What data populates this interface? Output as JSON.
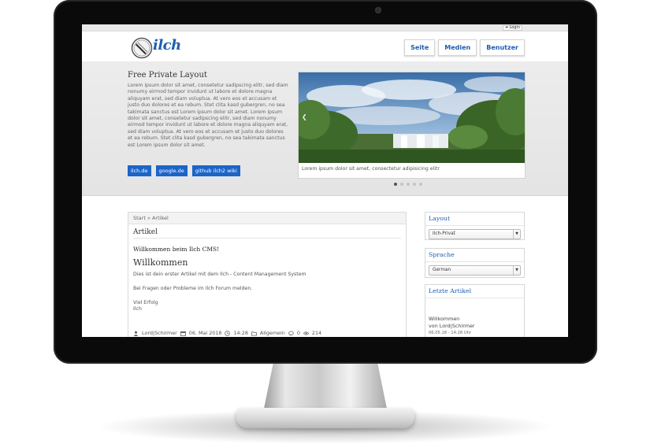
{
  "topbar": {
    "login_label": "Login"
  },
  "header": {
    "logo_text": "ilch",
    "nav": [
      "Seite",
      "Medien",
      "Benutzer"
    ]
  },
  "hero": {
    "title": "Free Private Layout",
    "text": "Lorem ipsum dolor sit amet, consetetur sadipscing elitr, sed diam nonumy eirmod tempor invidunt ut labore et dolore magna aliquyam erat, sed diam voluptua. At vero eos et accusam et justo duo dolores et ea rebum. Stet clita kasd gubergren, no sea takimata sanctus est Lorem ipsum dolor sit amet. Lorem ipsum dolor sit amet, consetetur sadipscing elitr, sed diam nonumy eirmod tempor invidunt ut labore et dolore magna aliquyam erat, sed diam voluptua. At vero eos et accusam et justo duo dolores et ea rebum. Stet clita kasd gubergren, no sea takimata sanctus est Lorem ipsum dolor sit amet.",
    "links": [
      "ilch.de",
      "google.de",
      "github ilch2 wiki"
    ],
    "slider_caption": "Lorem ipsum dolor sit amet, consectetur adipisicing elitr",
    "slide_count": 5,
    "active_slide": 1
  },
  "article": {
    "breadcrumb": "Start » Artikel",
    "heading": "Artikel",
    "subtitle": "Willkommen beim Ilch CMS!",
    "title": "Willkommen",
    "para1": "Dies ist dein erster Artikel mit dem Ilch - Content Management System",
    "para2": "Bei Fragen oder Probleme im Ilch Forum melden.",
    "para3a": "Viel Erfolg",
    "para3b": "Ilch",
    "meta": {
      "author": "Lord|Schirmer",
      "date": "06. Mai 2018",
      "time": "14:28",
      "category": "Allgemein",
      "comments": "0",
      "views": "214"
    }
  },
  "sidebar": {
    "layout": {
      "title": "Layout",
      "selected": "Ilch-Privat"
    },
    "language": {
      "title": "Sprache",
      "selected": "German"
    },
    "recent": {
      "title": "Letzte Artikel",
      "item_title": "Willkommen",
      "item_author": "von Lord|Schirmer",
      "item_date": "06.05.18 - 14:28 Uhr"
    }
  }
}
